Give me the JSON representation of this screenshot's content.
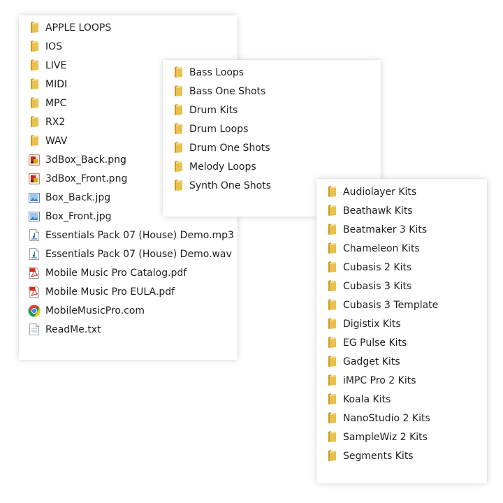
{
  "colors": {
    "folder_front": "#e8c14f",
    "folder_back": "#c99a22",
    "pdf_red": "#d62b1f",
    "chrome_red": "#db4437",
    "chrome_yellow": "#f4c20d",
    "chrome_green": "#0f9d58",
    "chrome_blue": "#4285f4",
    "audio_blue": "#3b6fc4"
  },
  "root_panel": {
    "items": [
      {
        "label": "APPLE LOOPS",
        "icon": "folder-icon"
      },
      {
        "label": "IOS",
        "icon": "folder-icon"
      },
      {
        "label": "LIVE",
        "icon": "folder-icon"
      },
      {
        "label": "MIDI",
        "icon": "folder-icon"
      },
      {
        "label": "MPC",
        "icon": "folder-icon"
      },
      {
        "label": "RX2",
        "icon": "folder-icon"
      },
      {
        "label": "WAV",
        "icon": "folder-icon"
      },
      {
        "label": "3dBox_Back.png",
        "icon": "png-image-icon"
      },
      {
        "label": "3dBox_Front.png",
        "icon": "png-image-icon"
      },
      {
        "label": "Box_Back.jpg",
        "icon": "jpg-image-icon"
      },
      {
        "label": "Box_Front.jpg",
        "icon": "jpg-image-icon"
      },
      {
        "label": "Essentials Pack 07 (House) Demo.mp3",
        "icon": "audio-file-icon"
      },
      {
        "label": "Essentials Pack 07 (House) Demo.wav",
        "icon": "audio-file-icon"
      },
      {
        "label": "Mobile Music Pro Catalog.pdf",
        "icon": "pdf-icon"
      },
      {
        "label": "Mobile Music Pro EULA.pdf",
        "icon": "pdf-icon"
      },
      {
        "label": "MobileMusicPro.com",
        "icon": "chrome-icon"
      },
      {
        "label": "ReadMe.txt",
        "icon": "text-file-icon"
      }
    ]
  },
  "wav_panel": {
    "items": [
      {
        "label": "Bass Loops",
        "icon": "folder-icon"
      },
      {
        "label": "Bass One Shots",
        "icon": "folder-icon"
      },
      {
        "label": "Drum Kits",
        "icon": "folder-icon"
      },
      {
        "label": "Drum Loops",
        "icon": "folder-icon"
      },
      {
        "label": "Drum One Shots",
        "icon": "folder-icon"
      },
      {
        "label": "Melody Loops",
        "icon": "folder-icon"
      },
      {
        "label": "Synth One Shots",
        "icon": "folder-icon"
      }
    ]
  },
  "mpc_panel": {
    "items": [
      {
        "label": "Audiolayer Kits",
        "icon": "folder-icon"
      },
      {
        "label": "Beathawk Kits",
        "icon": "folder-icon"
      },
      {
        "label": "Beatmaker 3 Kits",
        "icon": "folder-icon"
      },
      {
        "label": "Chameleon Kits",
        "icon": "folder-icon"
      },
      {
        "label": "Cubasis 2 Kits",
        "icon": "folder-icon"
      },
      {
        "label": "Cubasis 3 Kits",
        "icon": "folder-icon"
      },
      {
        "label": "Cubasis 3 Template",
        "icon": "folder-icon"
      },
      {
        "label": "Digistix Kits",
        "icon": "folder-icon"
      },
      {
        "label": "EG Pulse Kits",
        "icon": "folder-icon"
      },
      {
        "label": "Gadget Kits",
        "icon": "folder-icon"
      },
      {
        "label": "iMPC Pro 2 Kits",
        "icon": "folder-icon"
      },
      {
        "label": "Koala Kits",
        "icon": "folder-icon"
      },
      {
        "label": "NanoStudio 2 Kits",
        "icon": "folder-icon"
      },
      {
        "label": "SampleWiz 2 Kits",
        "icon": "folder-icon"
      },
      {
        "label": "Segments Kits",
        "icon": "folder-icon"
      }
    ]
  }
}
